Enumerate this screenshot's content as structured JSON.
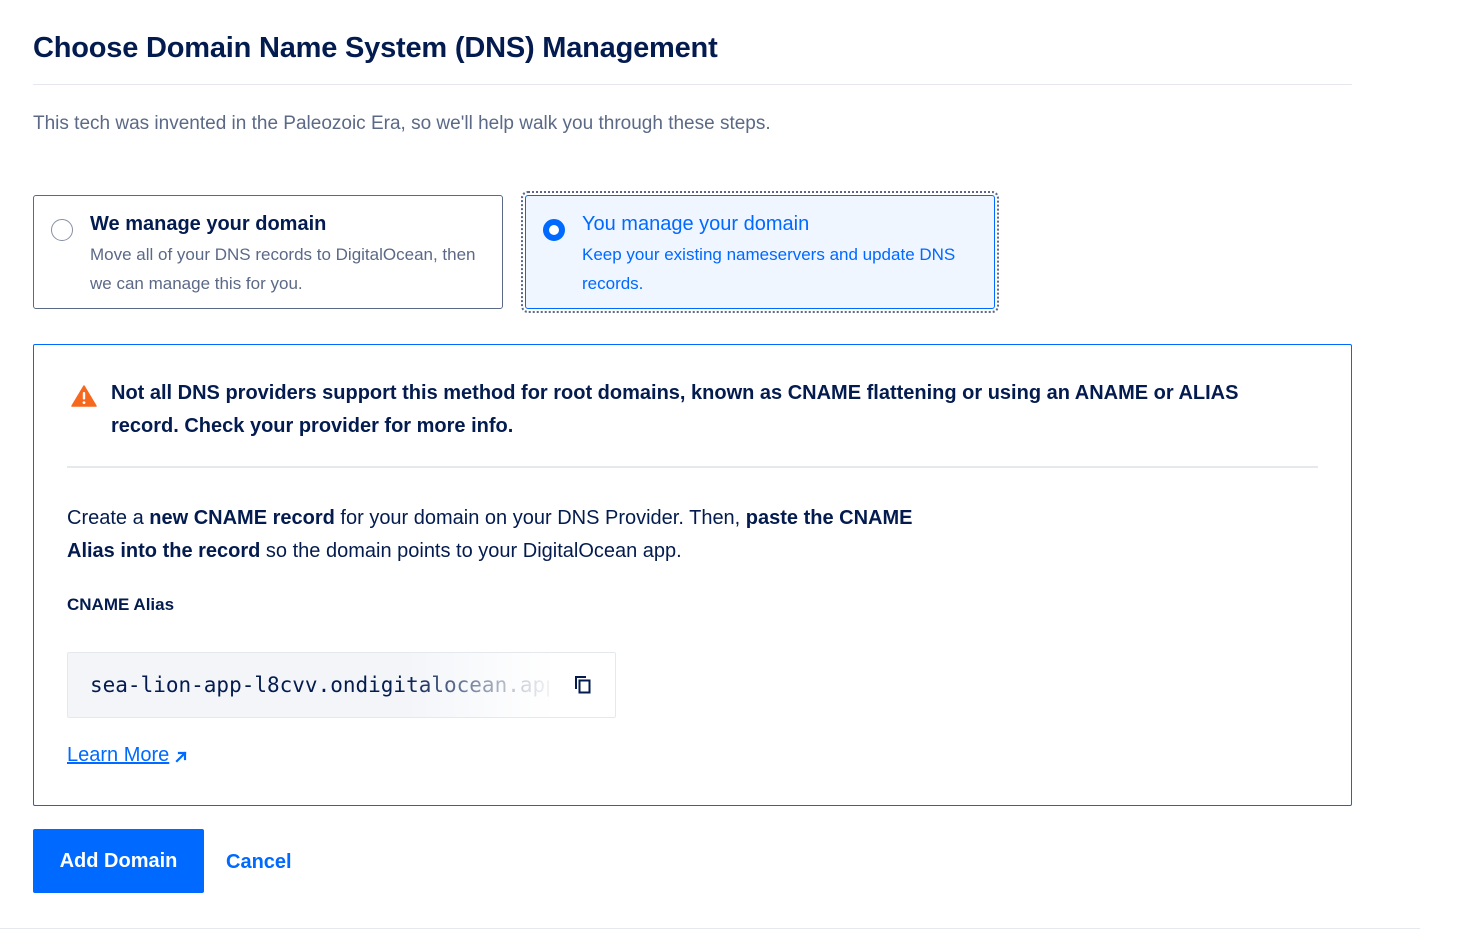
{
  "header": {
    "title": "Choose Domain Name System (DNS) Management",
    "intro": "This tech was invented in the Paleozoic Era, so we'll help walk you through these steps."
  },
  "options": [
    {
      "title": "We manage your domain",
      "description": "Move all of your DNS records to DigitalOcean, then we can manage this for you.",
      "selected": false
    },
    {
      "title": "You manage your domain",
      "description": "Keep your existing nameservers and update DNS records.",
      "selected": true
    }
  ],
  "panel": {
    "warning": "Not all DNS providers support this method for root domains, known as CNAME flattening or using an ANAME or ALIAS record. Check your provider for more info.",
    "instructions": {
      "part1": "Create a ",
      "bold1": "new CNAME record",
      "part2": " for your domain on your DNS Provider. Then, ",
      "bold2": "paste the CNAME Alias into the record",
      "part3": " so the domain points to your DigitalOcean app."
    },
    "alias_label": "CNAME Alias",
    "alias_value": "sea-lion-app-l8cvv.ondigitalocean.app",
    "learn_more": "Learn More",
    "icons": {
      "warning": "warning-triangle-icon",
      "copy": "copy-icon",
      "external_link": "arrow-up-right-icon"
    }
  },
  "actions": {
    "add_label": "Add Domain",
    "cancel_label": "Cancel"
  },
  "colors": {
    "primary": "#0069ff",
    "text_dark": "#031b4e",
    "text_muted": "#5b6987",
    "warning": "#f5681e",
    "selected_bg": "#f0f6ff"
  }
}
